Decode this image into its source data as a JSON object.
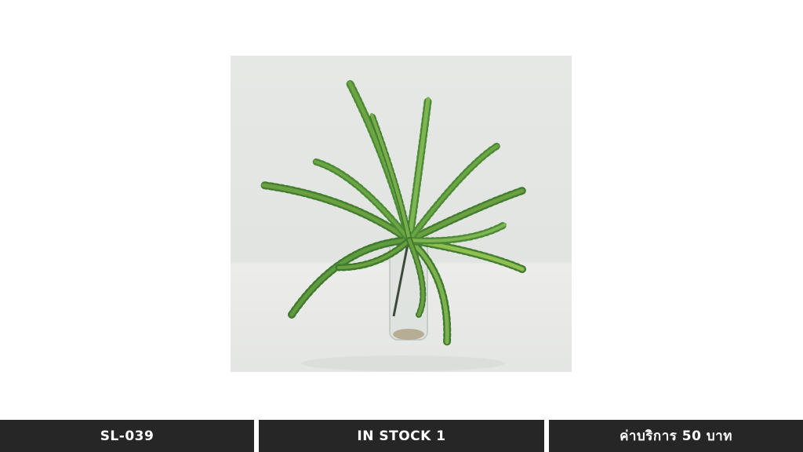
{
  "product": {
    "image_subject": "fern-plant-in-glass-vase",
    "colors": {
      "bar_background": "#262626",
      "bar_text": "#ffffff",
      "photo_backdrop": "#e3e6e3",
      "leaf_dark": "#3f7a2e",
      "leaf_light": "#8fbf4f"
    }
  },
  "footer": {
    "code": "SL-039",
    "stock": "IN STOCK 1",
    "service_fee": "ค่าบริการ 50 บาท"
  }
}
